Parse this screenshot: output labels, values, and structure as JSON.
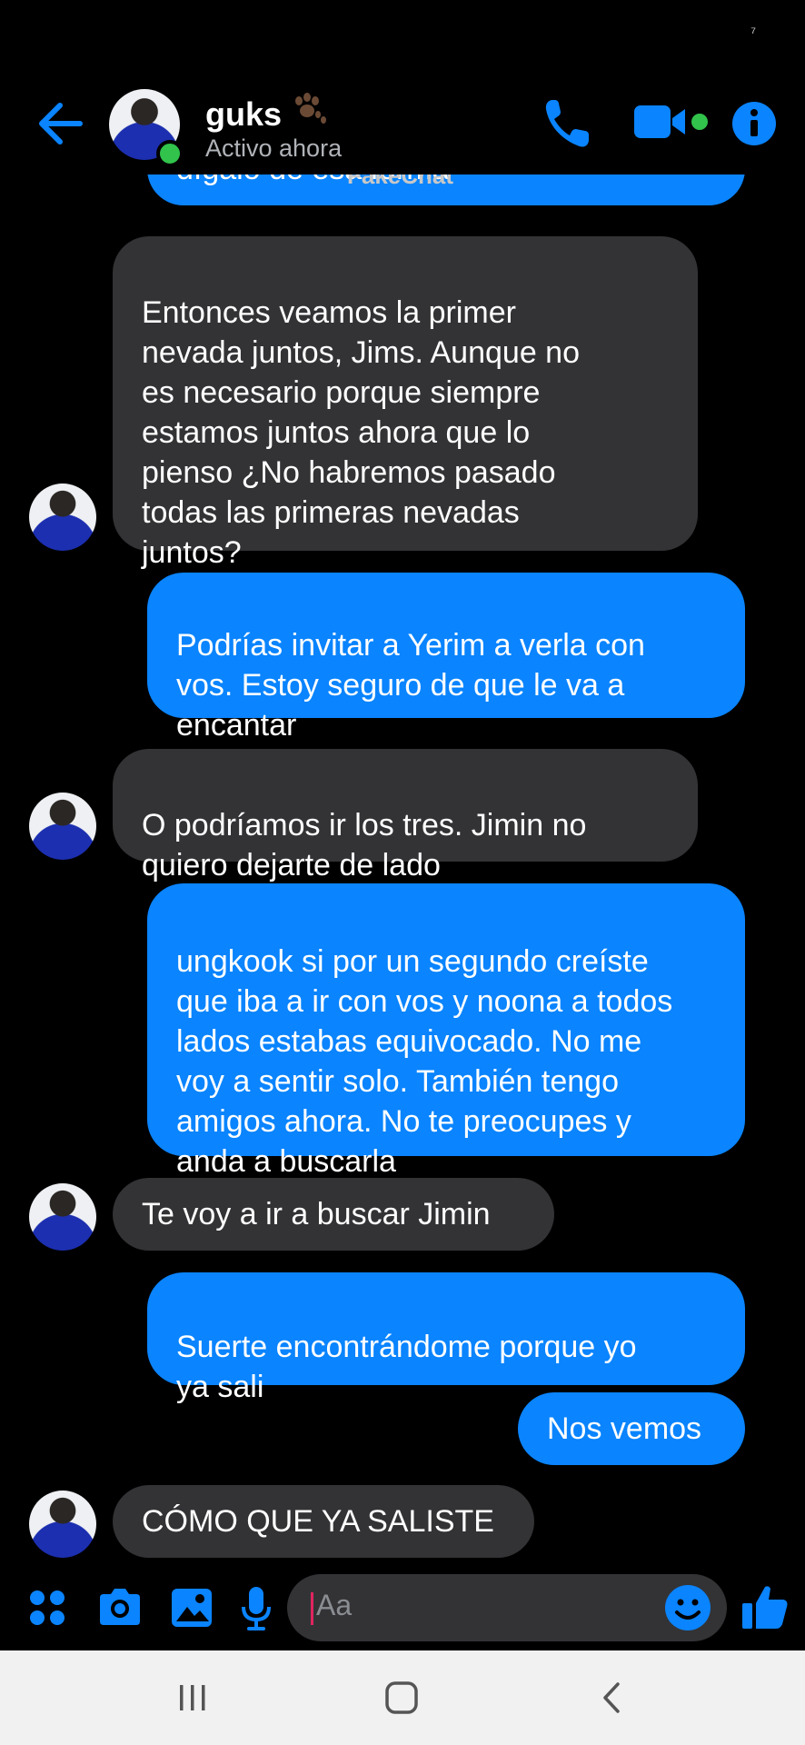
{
  "status_bar": {
    "mark": "⁷"
  },
  "header": {
    "contact_name": "guks",
    "contact_status": "Activo ahora"
  },
  "watermark": "FakeChat",
  "messages": [
    {
      "from": "me",
      "text": "dígalo de esa forma"
    },
    {
      "from": "them",
      "text": "Entonces veamos la primer\nnevada juntos, Jims. Aunque no\nes necesario porque siempre\nestamos juntos ahora que lo\npienso ¿No habremos pasado\ntodas las primeras nevadas\njuntos?"
    },
    {
      "from": "me",
      "text": "Podrías invitar a Yerim a verla con\nvos. Estoy seguro de que le va a\nencantar"
    },
    {
      "from": "them",
      "text": "O podríamos ir los tres. Jimin no\nquiero dejarte de lado"
    },
    {
      "from": "me",
      "text": "ungkook si por un segundo creíste\nque iba a ir con vos y noona a todos\nlados estabas equivocado. No me\nvoy a sentir solo. También tengo\namigos ahora. No te preocupes y\nanda a buscarla"
    },
    {
      "from": "them",
      "text": "Te voy a ir a buscar Jimin"
    },
    {
      "from": "me",
      "text": "Suerte encontrándome porque yo\nya sali"
    },
    {
      "from": "me",
      "text": "Nos vemos"
    },
    {
      "from": "them",
      "text": "CÓMO QUE YA SALISTE"
    }
  ],
  "composer": {
    "placeholder": "Aa"
  },
  "icons": {
    "back": "arrow-left-icon",
    "call": "phone-icon",
    "video": "video-camera-icon",
    "info": "info-icon",
    "apps": "grid-icon",
    "camera": "camera-icon",
    "gallery": "image-icon",
    "mic": "microphone-icon",
    "emoji": "smiley-icon",
    "like": "thumbs-up-icon"
  },
  "colors": {
    "accent": "#0a84ff",
    "incoming_bubble": "#333336",
    "online": "#31c34c",
    "background": "#000000"
  }
}
